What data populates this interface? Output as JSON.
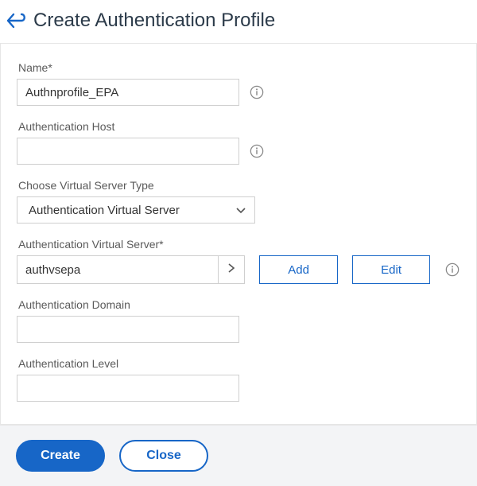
{
  "header": {
    "title": "Create Authentication Profile"
  },
  "form": {
    "name": {
      "label": "Name*",
      "value": "Authnprofile_EPA"
    },
    "auth_host": {
      "label": "Authentication Host",
      "value": ""
    },
    "vstype": {
      "label": "Choose Virtual Server Type",
      "selected": "Authentication Virtual Server"
    },
    "avs": {
      "label": "Authentication Virtual Server*",
      "value": "authvsepa",
      "add_label": "Add",
      "edit_label": "Edit"
    },
    "auth_domain": {
      "label": "Authentication Domain",
      "value": ""
    },
    "auth_level": {
      "label": "Authentication Level",
      "value": ""
    }
  },
  "footer": {
    "create_label": "Create",
    "close_label": "Close"
  }
}
